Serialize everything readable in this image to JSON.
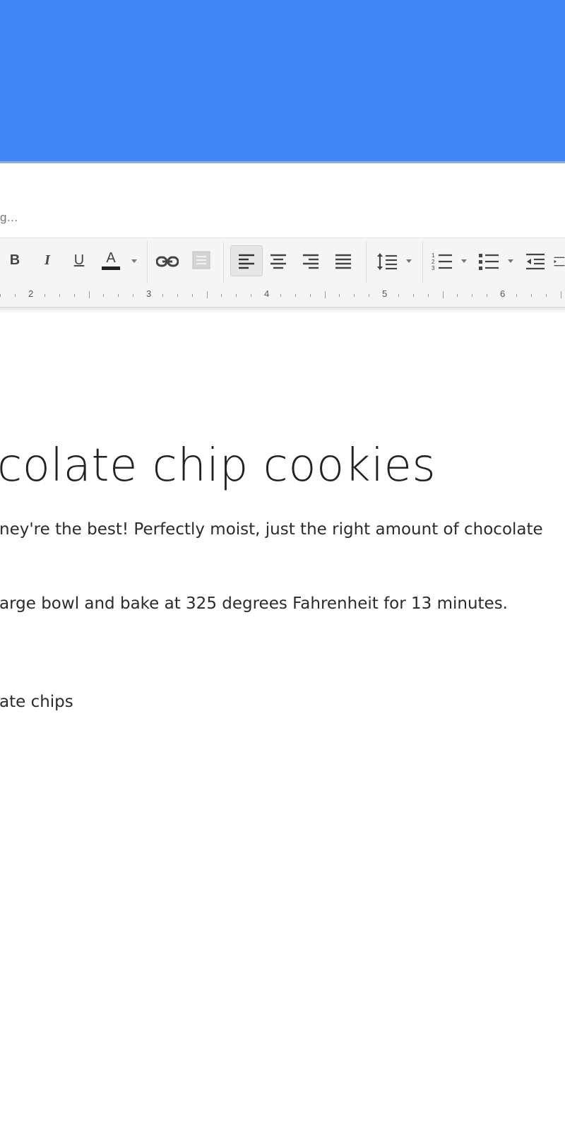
{
  "app": {
    "header_color": "#4285f4",
    "status_text": "g..."
  },
  "toolbar": {
    "bold_label": "B",
    "italic_label": "I",
    "underline_label": "U",
    "text_color_label": "A",
    "text_color_value": "#222222",
    "icons": [
      "bold-icon",
      "italic-icon",
      "underline-icon",
      "text-color-icon",
      "link-icon",
      "comment-icon",
      "align-left-icon",
      "align-center-icon",
      "align-right-icon",
      "align-justify-icon",
      "line-spacing-icon",
      "numbered-list-icon",
      "bulleted-list-icon",
      "decrease-indent-icon"
    ],
    "active_alignment": "left"
  },
  "ruler": {
    "numbers": [
      "2",
      "3",
      "4",
      "5",
      "6"
    ]
  },
  "document": {
    "title": "colate chip cookies",
    "paragraph_1": "ney're the best!  Perfectly moist, just the right amount of chocolate",
    "paragraph_2": "arge bowl and bake at 325 degrees Fahrenheit for 13 minutes.",
    "paragraph_3": "ate chips"
  }
}
